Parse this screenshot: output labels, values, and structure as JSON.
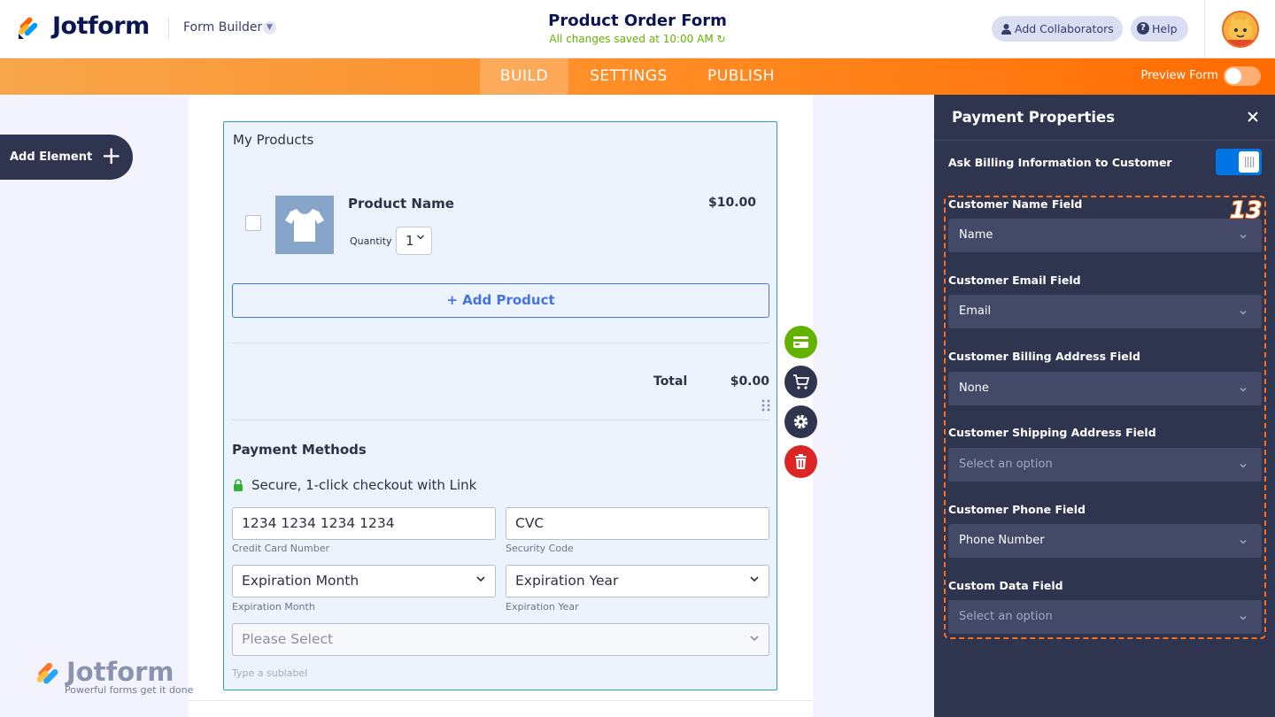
{
  "header": {
    "logo_text": "Jotform",
    "builder_label": "Form Builder",
    "form_title": "Product Order Form",
    "saved_status": "All changes saved at 10:00 AM",
    "collaborators_label": "Add Collaborators",
    "help_label": "Help",
    "icons": [
      "jotform-logo-icon",
      "chevron-down-icon",
      "refresh-icon",
      "user-icon",
      "question-icon",
      "avatar"
    ]
  },
  "nav": {
    "tabs": [
      {
        "label": "BUILD",
        "active": true
      },
      {
        "label": "SETTINGS",
        "active": false
      },
      {
        "label": "PUBLISH",
        "active": false
      }
    ],
    "preview_label": "Preview Form",
    "preview_on": false
  },
  "sidebar": {
    "add_element_label": "Add Element"
  },
  "form": {
    "section_title": "My Products",
    "product": {
      "name": "Product Name",
      "price": "$10.00",
      "quantity_label": "Quantity",
      "quantity_value": "1"
    },
    "add_product_label": "+ Add Product",
    "total_label": "Total",
    "total_value": "$0.00",
    "payment_methods_title": "Payment Methods",
    "secure_text": "Secure, 1-click checkout with Link",
    "card_number_value": "1234 1234 1234 1234",
    "card_number_sub": "Credit Card Number",
    "cvc_value": "CVC",
    "cvc_sub": "Security Code",
    "exp_month_value": "Expiration Month",
    "exp_month_sub": "Expiration Month",
    "exp_year_value": "Expiration Year",
    "exp_year_sub": "Expiration Year",
    "please_select": "Please Select",
    "sublabel_placeholder": "Type a sublabel"
  },
  "tools": [
    "credit-card-icon",
    "cart-icon",
    "gear-icon",
    "trash-icon"
  ],
  "watermark": {
    "logo_text": "Jotform",
    "tagline": "Powerful forms get it done"
  },
  "panel": {
    "title": "Payment Properties",
    "billing_label": "Ask Billing Information to Customer",
    "billing_on": true,
    "badge": "13",
    "fields": [
      {
        "label": "Customer Name Field",
        "value": "Name"
      },
      {
        "label": "Customer Email Field",
        "value": "Email"
      },
      {
        "label": "Customer Billing Address Field",
        "value": "None"
      },
      {
        "label": "Customer Shipping Address Field",
        "value": "Select an option"
      },
      {
        "label": "Customer Phone Field",
        "value": "Phone Number"
      },
      {
        "label": "Custom Data Field",
        "value": "Select an option"
      }
    ]
  },
  "colors": {
    "brand_orange": "#ff6f1a",
    "brand_navy": "#0a1551",
    "save_green": "#64b200",
    "accent_blue": "#4573e0",
    "panel_bg": "#2f344f",
    "toggle_blue": "#0075e3",
    "delete_red": "#dc2626"
  }
}
